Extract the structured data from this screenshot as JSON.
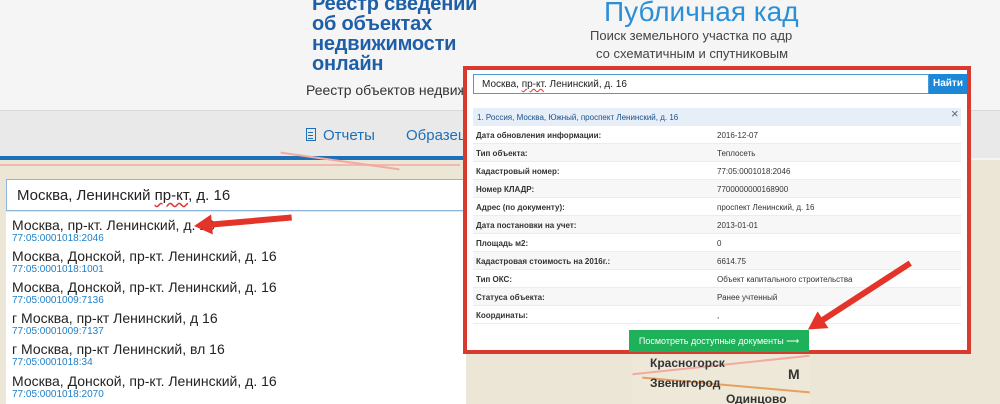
{
  "header": {
    "logo_title": "Реестр сведений об объектах недвижимости онлайн",
    "logo_subtitle": "Реестр объектов недвиж",
    "public_title": "Публичная кад",
    "public_sub1": "Поиск земельного участка по адр",
    "public_sub2": "со схематичным и спутниковым"
  },
  "nav": {
    "reports": "Отчеты",
    "samples": "Образец"
  },
  "left_search": {
    "before": "Москва, Ленинский ",
    "underlined": "пр-кт",
    "after": ", д. 16"
  },
  "results": [
    {
      "addr": "Москва, пр-кт. Ленинский, д. 16",
      "code": "77:05:0001018:2046"
    },
    {
      "addr": "Москва, Донской, пр-кт. Ленинский, д. 16",
      "code": "77:05:0001018:1001"
    },
    {
      "addr": "Москва, Донской, пр-кт. Ленинский, д. 16",
      "code": "77:05:0001009:7136"
    },
    {
      "addr": "г Москва, пр-кт Ленинский, д 16",
      "code": "77:05:0001009:7137"
    },
    {
      "addr": "г Москва, пр-кт Ленинский, вл 16",
      "code": "77:05:0001018:34"
    },
    {
      "addr": "Москва, Донской, пр-кт. Ленинский, д. 16",
      "code": "77:05:0001018:2070"
    }
  ],
  "popup": {
    "search_before": "Москва, ",
    "search_underlined": "пр-кт",
    "search_after": ". Ленинский, д. 16",
    "find_label": "Найти",
    "heading": "1. Россия, Москва, Южный, проспект Ленинский, д. 16",
    "close": "×",
    "rows": [
      {
        "k": "Дата обновления информации:",
        "v": "2016-12-07"
      },
      {
        "k": "Тип объекта:",
        "v": "Теплосеть"
      },
      {
        "k": "Кадастровый номер:",
        "v": "77:05:0001018:2046"
      },
      {
        "k": "Номер КЛАДР:",
        "v": "7700000000168900"
      },
      {
        "k": "Адрес (по документу):",
        "v": "проспект Ленинский, д. 16"
      },
      {
        "k": "Дата постановки на учет:",
        "v": "2013-01-01"
      },
      {
        "k": "Площадь м2:",
        "v": "0"
      },
      {
        "k": "Кадастровая стоимость на 2016г.:",
        "v": "6614.75"
      },
      {
        "k": "Тип ОКС:",
        "v": "Объект капитального строительства"
      },
      {
        "k": "Статуса объекта:",
        "v": "Ранее учтенный"
      },
      {
        "k": "Координаты:",
        "v": ","
      }
    ],
    "docs_button": "Посмотреть доступные документы ⟶"
  },
  "map": {
    "city1": "Красногорск",
    "city2": "Звенигород",
    "city3": "Одинцово",
    "city4": "М"
  },
  "colors": {
    "accent_blue": "#1e6fb8",
    "highlight_red": "#d93a2e",
    "button_green": "#1fb15a"
  }
}
